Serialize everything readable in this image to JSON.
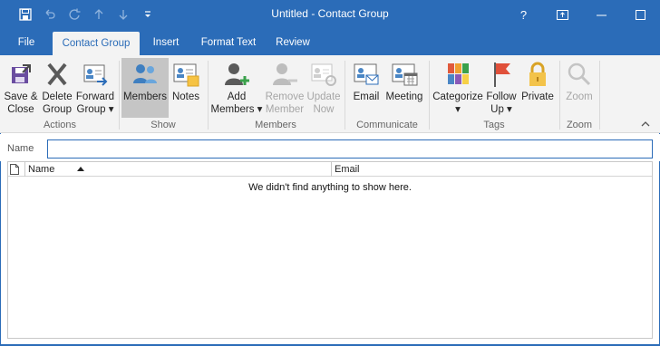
{
  "window": {
    "title": "Untitled  -  Contact Group",
    "help_glyph": "?",
    "restore_glyph": "⧉",
    "minimize_glyph": "—",
    "maximize_glyph": "☐",
    "close_glyph": "✕",
    "accent_color": "#2b6cb8"
  },
  "quick_access": {
    "icons": [
      "save-icon",
      "undo-icon",
      "redo-icon",
      "up-arrow-icon",
      "down-arrow-icon",
      "customize-qat-icon"
    ]
  },
  "tabs": [
    {
      "label": "File"
    },
    {
      "label": "Contact Group",
      "active": true
    },
    {
      "label": "Insert"
    },
    {
      "label": "Format Text"
    },
    {
      "label": "Review"
    }
  ],
  "ribbon": {
    "groups": {
      "actions": "Actions",
      "show": "Show",
      "members": "Members",
      "communicate": "Communicate",
      "tags": "Tags",
      "zoom": "Zoom"
    },
    "buttons": {
      "save_close": {
        "line1": "Save &",
        "line2": "Close"
      },
      "delete_group": {
        "line1": "Delete",
        "line2": "Group"
      },
      "forward_group": {
        "line1": "Forward",
        "line2": "Group ▾"
      },
      "members": {
        "line1": "Members"
      },
      "notes": {
        "line1": "Notes"
      },
      "add_members": {
        "line1": "Add",
        "line2": "Members ▾"
      },
      "remove_member": {
        "line1": "Remove",
        "line2": "Member"
      },
      "update_now": {
        "line1": "Update",
        "line2": "Now"
      },
      "email": {
        "line1": "Email"
      },
      "meeting": {
        "line1": "Meeting"
      },
      "categorize": {
        "line1": "Categorize",
        "line2": "▾"
      },
      "follow_up": {
        "line1": "Follow",
        "line2": "Up ▾"
      },
      "private": {
        "line1": "Private"
      },
      "zoom": {
        "line1": "Zoom"
      }
    },
    "collapse_glyph": "⌃"
  },
  "name_field": {
    "label": "Name",
    "value": ""
  },
  "list": {
    "columns": {
      "name": "Name",
      "email": "Email"
    },
    "empty_message": "We didn't find anything to show here."
  }
}
